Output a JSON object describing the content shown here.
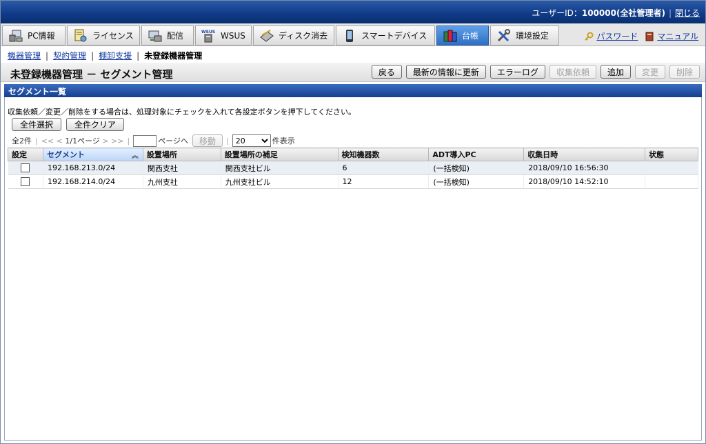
{
  "header": {
    "user_label": "ユーザーID：",
    "user_value": "100000(全社管理者)",
    "close_label": "閉じる"
  },
  "tabs": [
    {
      "label": "PC情報",
      "icon": "pc-icon"
    },
    {
      "label": "ライセンス",
      "icon": "license-icon"
    },
    {
      "label": "配信",
      "icon": "distribute-icon"
    },
    {
      "label": "WSUS",
      "icon": "wsus-icon"
    },
    {
      "label": "ディスク消去",
      "icon": "disk-erase-icon"
    },
    {
      "label": "スマートデバイス",
      "icon": "smartphone-icon"
    },
    {
      "label": "台帳",
      "icon": "ledger-icon",
      "active": true
    },
    {
      "label": "環境設定",
      "icon": "settings-icon"
    }
  ],
  "toplinks": {
    "password": "パスワード",
    "manual": "マニュアル"
  },
  "breadcrumb": {
    "item1": "機器管理",
    "item2": "契約管理",
    "item3": "棚卸支援",
    "current": "未登録機器管理"
  },
  "page": {
    "title": "未登録機器管理 － セグメント管理"
  },
  "toolbar": {
    "back": "戻る",
    "refresh": "最新の情報に更新",
    "errorlog": "エラーログ",
    "collect": "収集依頼",
    "add": "追加",
    "edit": "変更",
    "delete": "削除"
  },
  "section": {
    "title": "セグメント一覧"
  },
  "instruction": "収集依頼／変更／削除をする場合は、処理対象にチェックを入れて各設定ボタンを押下してください。",
  "selection": {
    "select_all": "全件選択",
    "clear_all": "全件クリア"
  },
  "pager": {
    "total": "全2件",
    "first": "<<",
    "prev": "<",
    "page_info": "1/1ページ",
    "next": ">",
    "last": ">>",
    "page_to_label": "ページへ",
    "go_label": "移動",
    "per_page_value": "20",
    "per_page_suffix": "件表示"
  },
  "table": {
    "columns": [
      "設定",
      "セグメント",
      "設置場所",
      "設置場所の補足",
      "検知機器数",
      "ADT導入PC",
      "収集日時",
      "状態"
    ],
    "rows": [
      {
        "segment": "192.168.213.0/24",
        "location": "関西支社",
        "location_note": "関西支社ビル",
        "count": "6",
        "adt_pc": "(一括検知)",
        "collected": "2018/09/10 16:56:30",
        "status": ""
      },
      {
        "segment": "192.168.214.0/24",
        "location": "九州支社",
        "location_note": "九州支社ビル",
        "count": "12",
        "adt_pc": "(一括検知)",
        "collected": "2018/09/10 14:52:10",
        "status": ""
      }
    ]
  }
}
